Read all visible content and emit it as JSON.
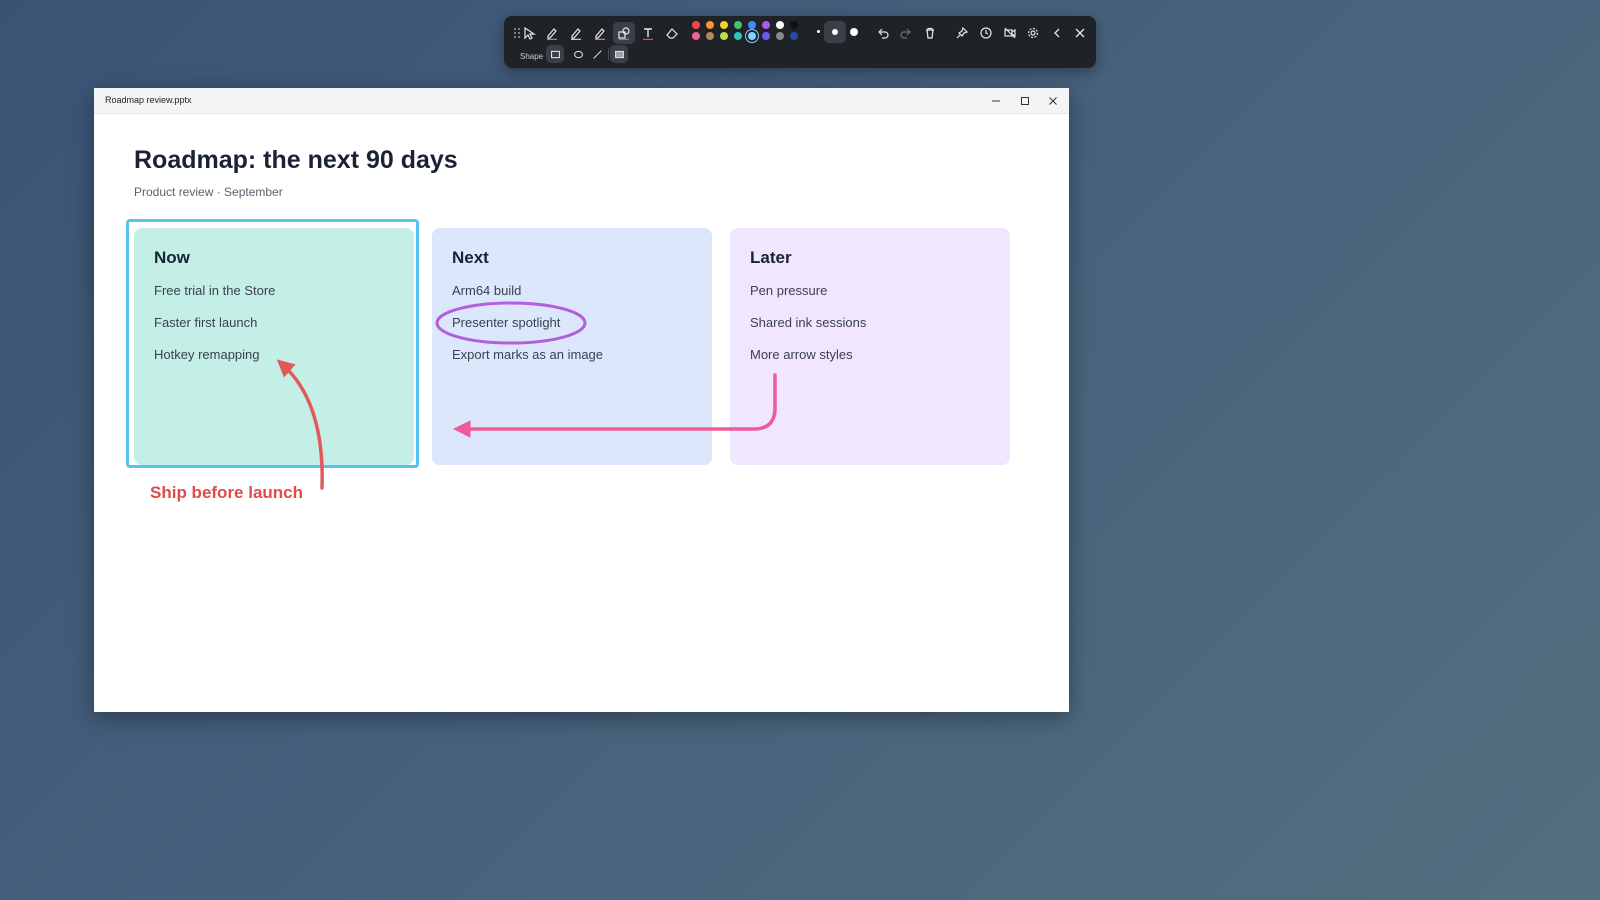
{
  "toolbar": {
    "tools": [
      "drag-handle",
      "select",
      "pen",
      "highlighter",
      "marker",
      "shape",
      "text",
      "eraser"
    ],
    "active_tool": "shape",
    "colors": [
      "#e84a4a",
      "#f39a2b",
      "#f3d22b",
      "#41c46b",
      "#3b8ff3",
      "#a95cf3",
      "#ffffff",
      "#111111",
      "#f06292",
      "#b08a5a",
      "#b5e04a",
      "#2bc6c0",
      "#7fd6ff",
      "#6a5cf3",
      "#888888",
      "#2a4aa8"
    ],
    "selected_color": "#7fd6ff",
    "sizes": [
      "small",
      "medium",
      "large"
    ],
    "selected_size": "medium",
    "actions": [
      "undo",
      "redo",
      "delete",
      "pin",
      "timer",
      "hide-window",
      "settings",
      "collapse",
      "close"
    ],
    "shape_label": "Shape",
    "shapes": [
      "rectangle",
      "ellipse",
      "line",
      "filled-rectangle"
    ],
    "selected_shape": "rectangle"
  },
  "window": {
    "title": "Roadmap review.pptx",
    "controls": [
      "minimize",
      "maximize",
      "close"
    ]
  },
  "slide": {
    "title": "Roadmap: the next 90 days",
    "subtitle": "Product review · September",
    "columns": [
      {
        "title": "Now",
        "items": [
          "Free trial in the Store",
          "Faster first launch",
          "Hotkey remapping"
        ],
        "color": "#c3efe6"
      },
      {
        "title": "Next",
        "items": [
          "Arm64 build",
          "Presenter spotlight",
          "Export marks as an image"
        ],
        "color": "#dce7fb"
      },
      {
        "title": "Later",
        "items": [
          "Pen pressure",
          "Shared ink sessions",
          "More arrow styles"
        ],
        "color": "#f0e6fd"
      }
    ]
  },
  "annotations": {
    "note_text": "Ship before launch",
    "colors": {
      "highlight": "#57c3ec",
      "arrow_red": "#e05a5a",
      "arrow_pink": "#ee5a9a",
      "ellipse": "#b45ee0",
      "note": "#e04a4a"
    }
  }
}
